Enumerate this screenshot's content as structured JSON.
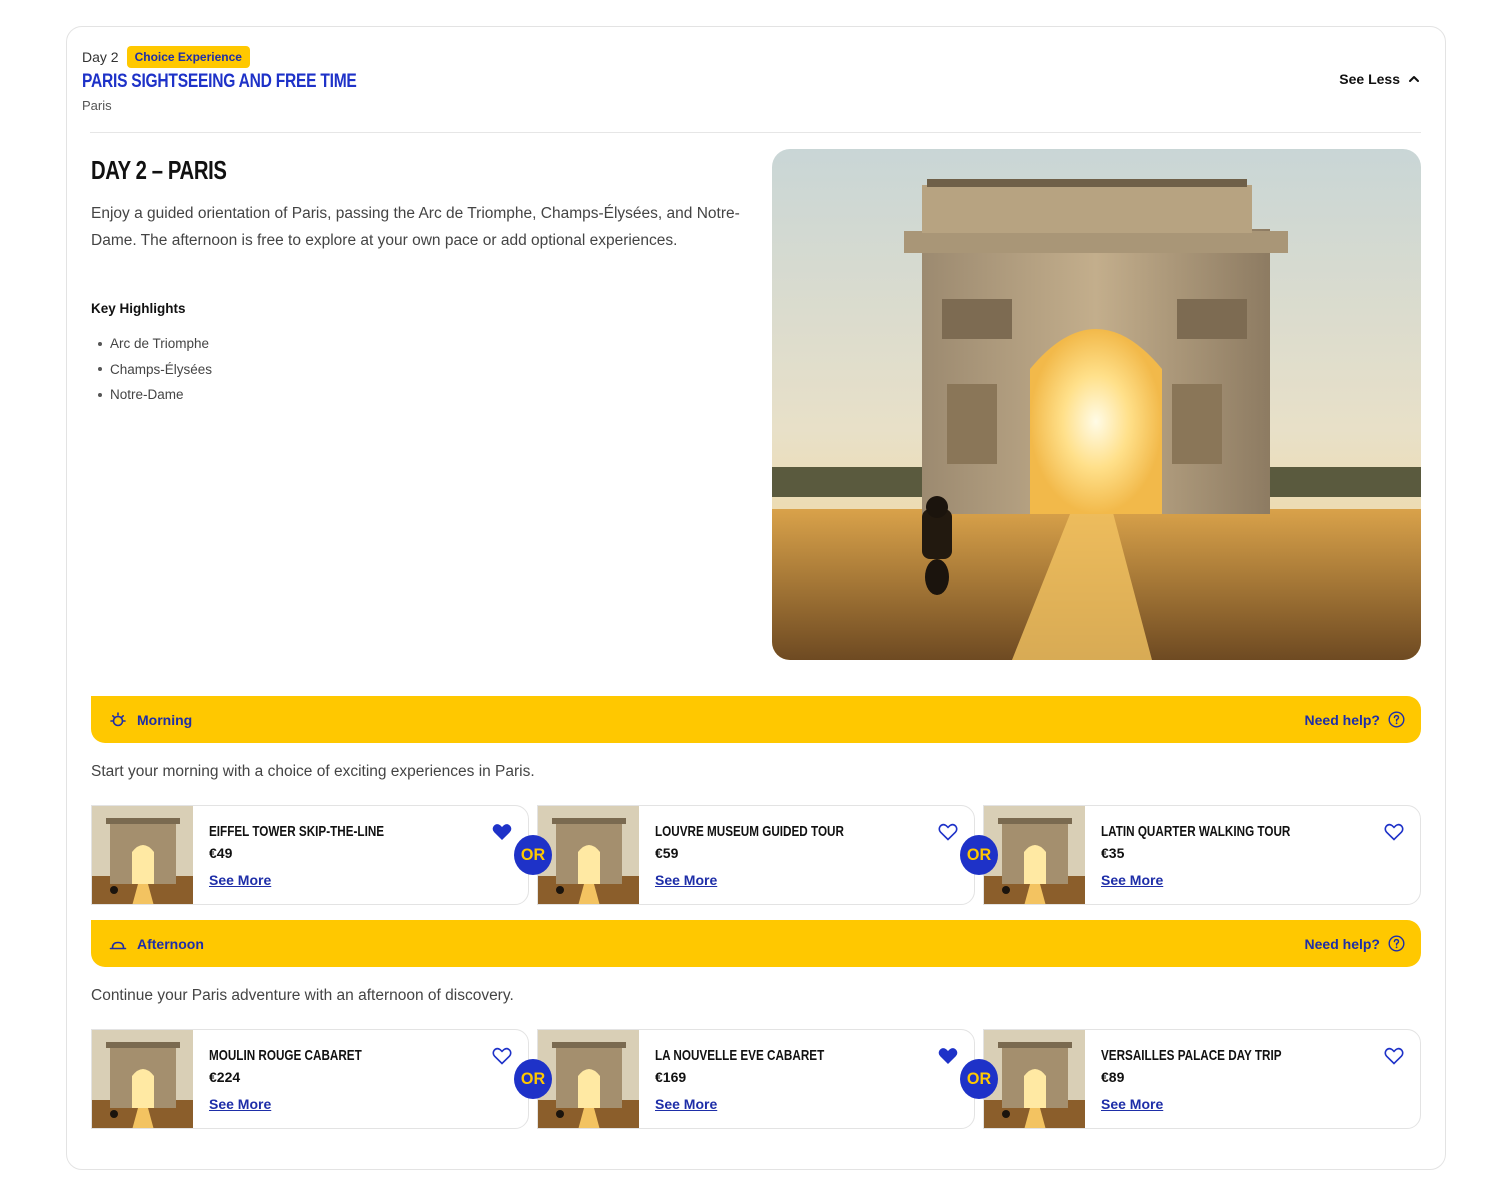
{
  "header": {
    "day_label": "Day 2",
    "badge": "Choice Experience",
    "title": "PARIS SIGHTSEEING AND FREE TIME",
    "subtitle": "Paris",
    "toggle_label": "See Less"
  },
  "body": {
    "title": "DAY 2 – PARIS",
    "description": "Enjoy a guided orientation of Paris, passing the Arc de Triomphe, Champs-Élysées, and Notre-Dame. The afternoon is free to explore at your own pace or add optional experiences.",
    "highlights_title": "Key Highlights",
    "highlights": [
      "Arc de Triomphe",
      "Champs-Élysées",
      "Notre-Dame"
    ]
  },
  "sections": [
    {
      "label": "Morning",
      "icon": "sun-icon",
      "help_label": "Need help?",
      "intro": "Start your morning with a choice of exciting experiences in Paris.",
      "options": [
        {
          "name": "Eiffel Tower Skip-the-Line",
          "price": "€49",
          "link": "See More",
          "favorited": true
        },
        {
          "name": "Louvre Museum Guided Tour",
          "price": "€59",
          "link": "See More",
          "favorited": false
        },
        {
          "name": "Latin Quarter Walking Tour",
          "price": "€35",
          "link": "See More",
          "favorited": false
        }
      ]
    },
    {
      "label": "Afternoon",
      "icon": "sunset-icon",
      "help_label": "Need help?",
      "intro": "Continue your Paris adventure with an afternoon of discovery.",
      "options": [
        {
          "name": "Moulin Rouge Cabaret",
          "price": "€224",
          "link": "See More",
          "favorited": false
        },
        {
          "name": "La Nouvelle Eve Cabaret",
          "price": "€169",
          "link": "See More",
          "favorited": true
        },
        {
          "name": "Versailles Palace Day Trip",
          "price": "€89",
          "link": "See More",
          "favorited": false
        }
      ]
    }
  ],
  "or_label": "OR",
  "colors": {
    "brand_blue": "#1e32c8",
    "accent_yellow": "#ffc800"
  }
}
